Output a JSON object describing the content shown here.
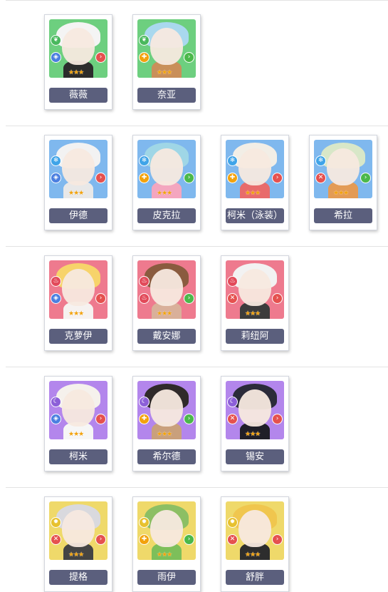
{
  "rows": [
    {
      "element": "nature",
      "cards": [
        {
          "name": "薇薇",
          "stars": "★★★",
          "element_icon": "leaf-icon",
          "class_icon": "shield-icon",
          "range_icon": "arrow-icon",
          "bg": "#6dcf7f",
          "hair": "#f4f4f4",
          "outfit": "#2c2c2c"
        },
        {
          "name": "奈亚",
          "stars": "★★★",
          "element_icon": "leaf-icon",
          "class_icon": "cross-icon",
          "range_icon": "arrow-icon",
          "bg": "#6dcf7f",
          "hair": "#a9d8ee",
          "outfit": "#c98f5a"
        }
      ]
    },
    {
      "element": "water",
      "cards": [
        {
          "name": "伊德",
          "stars": "★★★",
          "element_icon": "snowflake-icon",
          "class_icon": "shield-icon",
          "range_icon": "arrow-icon",
          "bg": "#7fb8ee",
          "hair": "#f2f2f2",
          "outfit": "#e8e8e8"
        },
        {
          "name": "皮克拉",
          "stars": "★★★",
          "element_icon": "snowflake-icon",
          "class_icon": "cross-icon",
          "range_icon": "arrow-icon",
          "bg": "#7fb8ee",
          "hair": "#9fd6e6",
          "outfit": "#f4a6bf"
        },
        {
          "name": "柯米（泳装）",
          "stars": "★★★",
          "element_icon": "snowflake-icon",
          "class_icon": "cross-icon",
          "range_icon": "arrow-icon",
          "bg": "#7fb8ee",
          "hair": "#f2eee6",
          "outfit": "#e86b6b"
        },
        {
          "name": "希拉",
          "stars": "★★★",
          "element_icon": "snowflake-icon",
          "class_icon": "sword-icon",
          "range_icon": "arrow-icon",
          "bg": "#7fb8ee",
          "hair": "#d8e7c8",
          "outfit": "#e39b55"
        }
      ]
    },
    {
      "element": "fire",
      "cards": [
        {
          "name": "克萝伊",
          "stars": "★★★",
          "element_icon": "flame-icon",
          "class_icon": "shield-icon",
          "range_icon": "arrow-icon",
          "bg": "#ee7a8e",
          "hair": "#f7d36a",
          "outfit": "#f6f2f0"
        },
        {
          "name": "戴安娜",
          "stars": "★★★",
          "element_icon": "flame-icon",
          "class_icon": "flame-icon",
          "range_icon": "arrow-icon",
          "bg": "#ee7a8e",
          "hair": "#8a5b3f",
          "outfit": "#d9b09a"
        },
        {
          "name": "莉纽阿",
          "stars": "★★★",
          "element_icon": "flame-icon",
          "class_icon": "sword-icon",
          "range_icon": "arrow-icon",
          "bg": "#ee7a8e",
          "hair": "#f2f2f2",
          "outfit": "#3c3c3c"
        }
      ]
    },
    {
      "element": "dark",
      "cards": [
        {
          "name": "柯米",
          "stars": "★★★",
          "element_icon": "moon-icon",
          "class_icon": "shield-icon",
          "range_icon": "arrow-icon",
          "bg": "#b386ec",
          "hair": "#f5f1ec",
          "outfit": "#f6f6f6"
        },
        {
          "name": "希尔德",
          "stars": "★★★",
          "element_icon": "moon-icon",
          "class_icon": "cross-icon",
          "range_icon": "arrow-icon",
          "bg": "#b386ec",
          "hair": "#2f2a2a",
          "outfit": "#c9a07c"
        },
        {
          "name": "锡安",
          "stars": "★★★",
          "element_icon": "moon-icon",
          "class_icon": "sword-icon",
          "range_icon": "arrow-icon",
          "bg": "#b386ec",
          "hair": "#2b2b3a",
          "outfit": "#1f1f28"
        }
      ]
    },
    {
      "element": "light",
      "cards": [
        {
          "name": "提格",
          "stars": "★★★",
          "element_icon": "sun-icon",
          "class_icon": "sword-icon",
          "range_icon": "arrow-icon",
          "bg": "#efd96a",
          "hair": "#d9d9de",
          "outfit": "#444444"
        },
        {
          "name": "雨伊",
          "stars": "★★★",
          "element_icon": "sun-icon",
          "class_icon": "cross-icon",
          "range_icon": "arrow-icon",
          "bg": "#efd96a",
          "hair": "#8cbf64",
          "outfit": "#7dbf5a"
        },
        {
          "name": "舒胖",
          "stars": "★★★",
          "element_icon": "sun-icon",
          "class_icon": "sword-icon",
          "range_icon": "arrow-icon",
          "bg": "#efd96a",
          "hair": "#f0c64e",
          "outfit": "#2d2d2d"
        }
      ]
    }
  ],
  "colors": {
    "name_plate": "#5b5f7d",
    "nature": "#49b85d",
    "water": "#3fa4e8",
    "fire": "#e24a5a",
    "dark": "#8c5fd8",
    "light": "#e7c12e",
    "class_orange": "#f2a20c",
    "class_blue": "#4b7fe0",
    "class_red": "#e5514f",
    "range_red": "#e5514f",
    "range_green": "#4bb84a"
  }
}
